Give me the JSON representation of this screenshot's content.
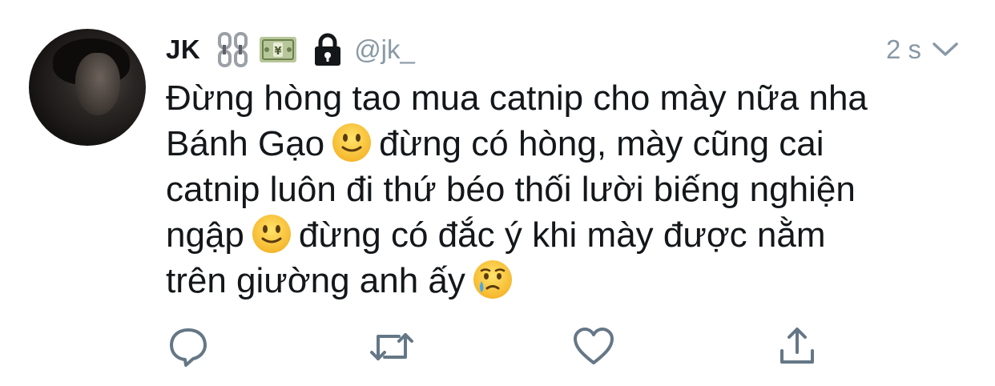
{
  "tweet": {
    "author": {
      "display_name": "JK",
      "name_emojis": [
        "chain-emoji",
        "money-emoji"
      ],
      "protected": true,
      "handle": "@jk_"
    },
    "timestamp": "2 s",
    "text_lines": [
      {
        "before": "Đừng hòng tao mua catnip cho mày nữa nha",
        "emoji": "",
        "after": ""
      },
      {
        "before": "Bánh Gạo",
        "emoji": "slightly-smiling-face",
        "after": "đừng có hòng, mày cũng cai"
      },
      {
        "before": "catnip luôn đi thứ béo thối lười biếng nghiện",
        "emoji": "",
        "after": ""
      },
      {
        "before": "ngập",
        "emoji": "slightly-smiling-face",
        "after": "đừng có đắc ý khi mày được nằm"
      },
      {
        "before": "trên giường anh ấy",
        "emoji": "crying-face",
        "after": ""
      }
    ],
    "actions": [
      {
        "name": "reply",
        "icon": "reply-icon"
      },
      {
        "name": "retweet",
        "icon": "retweet-icon"
      },
      {
        "name": "like",
        "icon": "heart-icon"
      },
      {
        "name": "share",
        "icon": "share-icon"
      }
    ]
  },
  "colors": {
    "text": "#14171a",
    "secondary": "#8899a6",
    "icon": "#657786",
    "background": "#ffffff"
  }
}
